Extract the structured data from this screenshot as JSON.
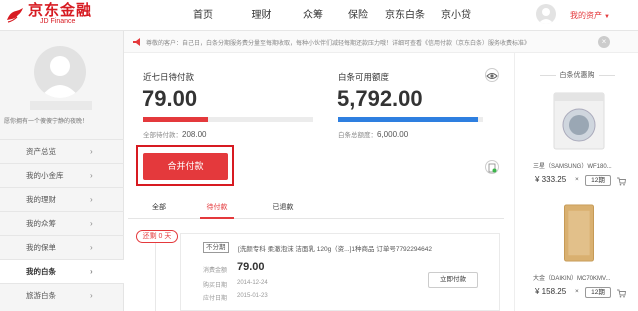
{
  "logo": {
    "cn": "京东金融",
    "en": "JD Finance"
  },
  "nav": [
    "首页",
    "理财",
    "众筹",
    "保险",
    "京东白条",
    "京小贷"
  ],
  "account": {
    "label": "我的资产"
  },
  "colors": {
    "brand": "#e4393c",
    "accent": "#2e7fe0"
  },
  "sidebar": {
    "greeting": "愿你拥有一个傻傻宁静的夜晚！",
    "items": [
      {
        "label": "资产总览"
      },
      {
        "label": "我的小金库"
      },
      {
        "label": "我的理财"
      },
      {
        "label": "我的众筹"
      },
      {
        "label": "我的保单"
      },
      {
        "label": "我的白条"
      },
      {
        "label": "旅游白条"
      }
    ]
  },
  "notice": {
    "text": "尊敬的客户：自己日，白条分期服务费分量至每期收取，每种小伙伴们减轻每期还款压力哦！详细可查看《信用付款（京东白条）服务收费标准》"
  },
  "summary": {
    "due7_label": "近七日待付款",
    "due7_value": "79.00",
    "total_due_label": "全部待付款：",
    "total_due_value": "208.00",
    "due_progress": 0.38,
    "credit_label": "白条可用额度",
    "credit_value": "5,792.00",
    "credit_limit_label": "白条总额度：",
    "credit_limit_value": "6,000.00",
    "credit_progress": 0.965,
    "pay_button": "合并付款"
  },
  "tabs": [
    "全部",
    "待付款",
    "已退款"
  ],
  "order": {
    "due_badge": "还剩 0 天",
    "tag": "不分期",
    "title": "[洗颜专科 柔澈泡沫 洁面乳 120g（资...]1种商品 订单号7792294642",
    "amount_label": "消费金额",
    "amount": "79.00",
    "purchase_label": "购买日期",
    "purchase_date": "2014-12-24",
    "due_label": "应付日期",
    "due_date": "2015-01-23",
    "pay_button": "立即付款"
  },
  "promo": {
    "title": "白条优惠购",
    "products": [
      {
        "name": "三星（SAMSUNG）WF180...",
        "price": "¥ 333.25",
        "times": "×",
        "term": "12期"
      },
      {
        "name": "大金（DAIKIN）MC70KMV...",
        "price": "¥ 158.25",
        "times": "×",
        "term": "12期"
      }
    ]
  }
}
